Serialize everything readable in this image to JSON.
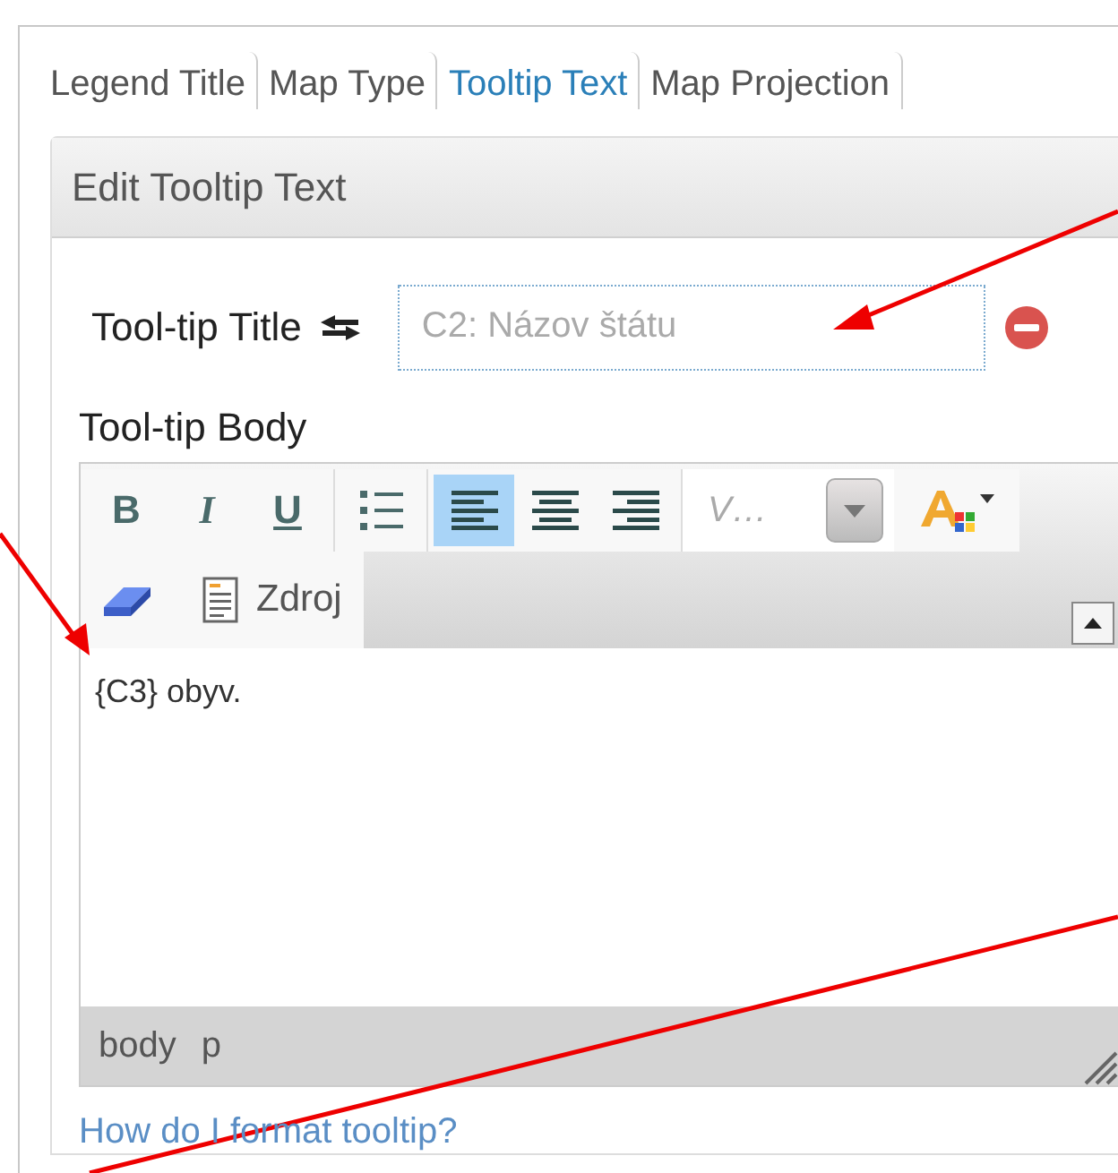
{
  "tabs": [
    {
      "label": "Legend Title",
      "selected": false
    },
    {
      "label": "Map Type",
      "selected": false
    },
    {
      "label": "Tooltip Text",
      "selected": true
    },
    {
      "label": "Map Projection",
      "selected": false
    }
  ],
  "panel": {
    "title": "Edit Tooltip Text",
    "title_field": {
      "label": "Tool-tip Title",
      "placeholder": "C2: Názov štátu"
    },
    "body_label": "Tool-tip Body",
    "toolbar": [
      [
        {
          "kind": "bold",
          "label": "B",
          "selected": false
        },
        {
          "kind": "italic",
          "label": "I",
          "selected": false
        },
        {
          "kind": "underline",
          "label": "U",
          "selected": false
        }
      ],
      [
        {
          "kind": "bullets",
          "selected": false
        }
      ],
      [
        {
          "kind": "align-left",
          "selected": true
        },
        {
          "kind": "align-center",
          "selected": false
        },
        {
          "kind": "align-right",
          "selected": false
        }
      ]
    ],
    "font_combo": {
      "value": "V…"
    },
    "source_button": {
      "label": "Zdroj"
    },
    "content": "{C3} obyv.",
    "path": [
      "body",
      "p"
    ],
    "help_link": "How do I format tooltip?"
  }
}
